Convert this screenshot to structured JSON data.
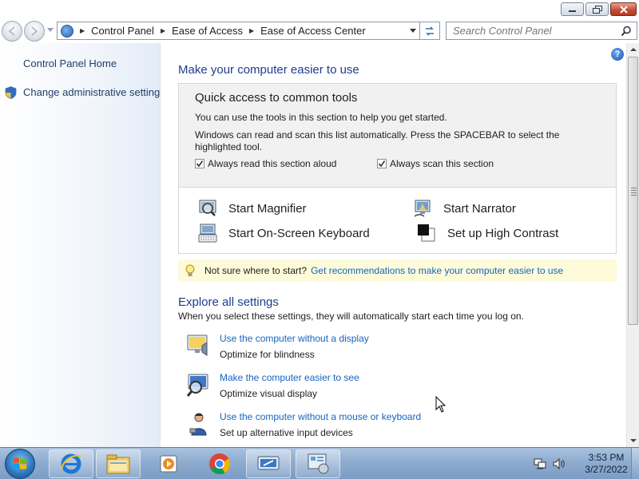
{
  "window": {
    "minimize_label": "Minimize",
    "maximize_label": "Maximize",
    "close_label": "Close"
  },
  "navigation": {
    "breadcrumbs": [
      "Control Panel",
      "Ease of Access",
      "Ease of Access Center"
    ],
    "search_placeholder": "Search Control Panel"
  },
  "sidebar": {
    "home_link": "Control Panel Home",
    "admin_link": "Change administrative settings"
  },
  "main": {
    "heading": "Make your computer easier to use",
    "quick_access": {
      "title": "Quick access to common tools",
      "line1": "You can use the tools in this section to help you get started.",
      "line2": "Windows can read and scan this list automatically.  Press the SPACEBAR to select the highlighted tool.",
      "checkbox_read": {
        "label": "Always read this section aloud",
        "checked": true
      },
      "checkbox_scan": {
        "label": "Always scan this section",
        "checked": true
      },
      "tools": {
        "magnifier": "Start Magnifier",
        "narrator": "Start Narrator",
        "osk": "Start On-Screen Keyboard",
        "high_contrast": "Set up High Contrast"
      }
    },
    "tip": {
      "text": "Not sure where to start?",
      "link": "Get recommendations to make your computer easier to use"
    },
    "explore": {
      "heading": "Explore all settings",
      "description": "When you select these settings, they will automatically start each time you log on.",
      "settings": [
        {
          "link": "Use the computer without a display",
          "desc": "Optimize for blindness",
          "icon": "monitor-speaker-icon"
        },
        {
          "link": "Make the computer easier to see",
          "desc": "Optimize visual display",
          "icon": "monitor-magnifier-icon"
        },
        {
          "link": "Use the computer without a mouse or keyboard",
          "desc": "Set up alternative input devices",
          "icon": "person-icon"
        }
      ]
    }
  },
  "taskbar": {
    "time": "3:53 PM",
    "date": "3/27/2022",
    "apps": [
      "internet-explorer-icon",
      "file-explorer-icon",
      "media-player-icon",
      "chrome-icon",
      "remote-desktop-icon",
      "control-panel-icon"
    ]
  },
  "colors": {
    "link": "#1565c0",
    "heading": "#1e3d8f",
    "tip_background": "#fdfbd9",
    "taskbar": "#8eaccf"
  }
}
